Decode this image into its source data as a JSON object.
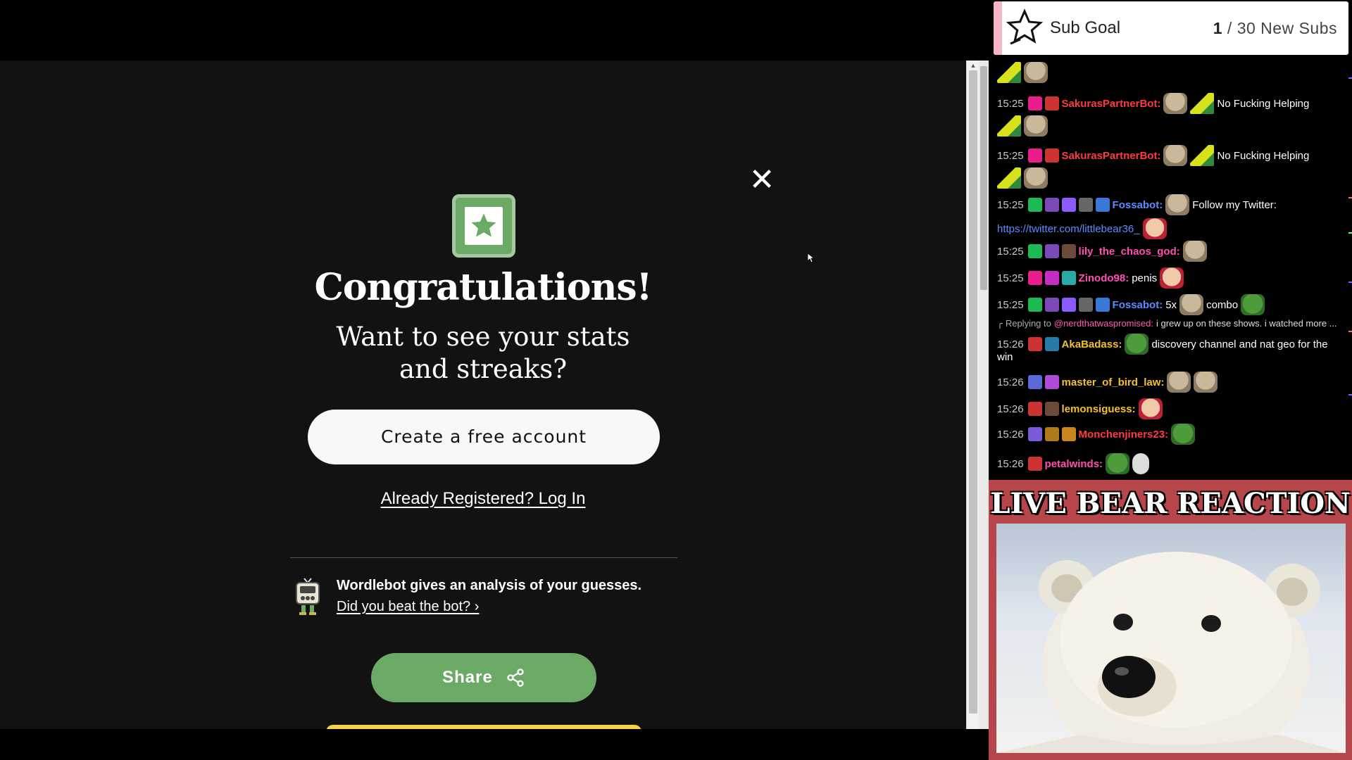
{
  "modal": {
    "close_symbol": "✕",
    "title": "Congratulations!",
    "subtitle_line1": "Want to see your stats",
    "subtitle_line2": "and streaks?",
    "create_account_label": "Create a free account",
    "login_link": "Already Registered? Log In",
    "wordlebot_text": "Wordlebot gives an analysis of your guesses.",
    "wordlebot_link": "Did you beat the bot? ›",
    "share_label": "Share"
  },
  "sub_goal": {
    "label": "Sub Goal",
    "current": "1",
    "rest": " / 30 New Subs"
  },
  "chat": {
    "messages": [
      {
        "time": "15:25",
        "user": "SakurasPartnerBot:",
        "text": "No Fucking Helping"
      },
      {
        "time": "15:25",
        "user": "SakurasPartnerBot:",
        "text": "No Fucking Helping"
      },
      {
        "time": "15:25",
        "user": "Fossabot:",
        "text": "Follow my Twitter:",
        "link": "https://twitter.com/littlebear36_"
      },
      {
        "time": "15:25",
        "user": "lily_the_chaos_god:",
        "text": ""
      },
      {
        "time": "15:25",
        "user": "Zinodo98:",
        "text": "penis"
      },
      {
        "time": "15:25",
        "user": "Fossabot:",
        "text": "5x",
        "text2": "combo"
      },
      {
        "reply_prefix": "Replying to",
        "reply_mention": "@nerdthatwaspromised:",
        "reply_text": "i grew up on these shows. i watched more ..."
      },
      {
        "time": "15:26",
        "user": "AkaBadass:",
        "text": "discovery channel and nat geo for the",
        "text_wrap": "win"
      },
      {
        "time": "15:26",
        "user": "master_of_bird_law:",
        "text": ""
      },
      {
        "time": "15:26",
        "user": "lemonsiguess:",
        "text": ""
      },
      {
        "time": "15:26",
        "user": "Monchenjiners23:",
        "text": ""
      },
      {
        "time": "15:26",
        "user": "petalwinds:",
        "text": ""
      }
    ]
  },
  "overlay": {
    "bear_title": "LIVE BEAR REACTION"
  },
  "colors": {
    "game_bg": "#121213",
    "green": "#6aaa64",
    "yellow": "#f5d547",
    "user_red": "#ff3b3b",
    "user_blue": "#5b8cff",
    "user_pink": "#ff4fb0",
    "user_gold": "#f2c12e",
    "bear_panel": "#b7464a"
  }
}
